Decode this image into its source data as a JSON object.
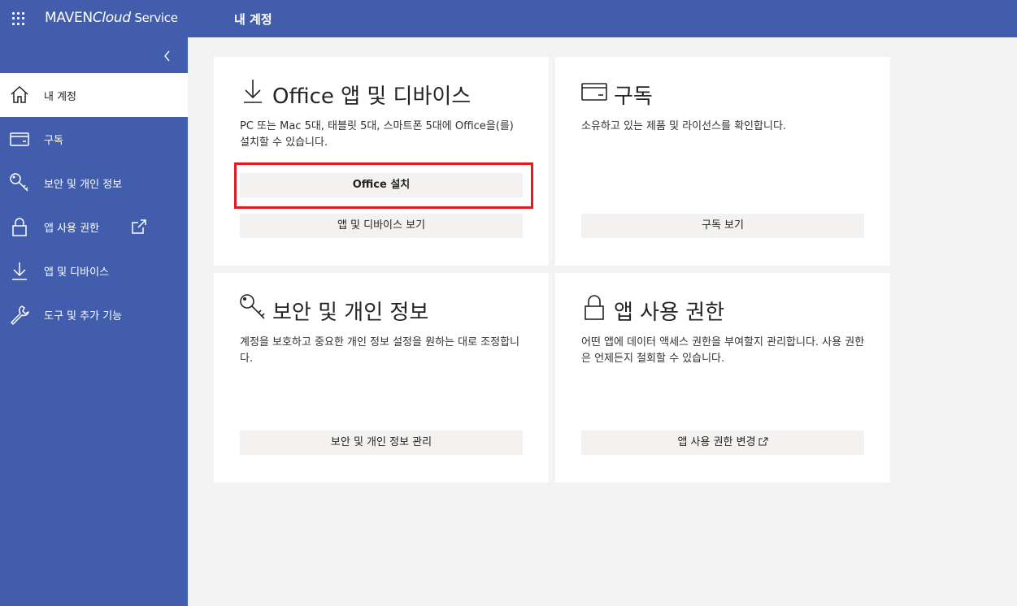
{
  "topbar": {
    "brand_prefix": "MAVEN",
    "brand_cloud": "Cloud",
    "brand_service": " Service",
    "title": "내 계정"
  },
  "sidebar": {
    "items": [
      {
        "label": "내 계정",
        "icon": "home-icon",
        "active": true
      },
      {
        "label": "구독",
        "icon": "card-icon"
      },
      {
        "label": "보안 및 개인 정보",
        "icon": "key-icon"
      },
      {
        "label": "앱 사용 권한",
        "icon": "lock-icon",
        "external": true
      },
      {
        "label": "앱 및 디바이스",
        "icon": "download-icon"
      },
      {
        "label": "도구 및 추가 기능",
        "icon": "wrench-icon"
      }
    ]
  },
  "cards": {
    "office": {
      "title": "Office 앱 및 디바이스",
      "desc": "PC 또는 Mac 5대, 태블릿 5대, 스마트폰 5대에 Office을(를) 설치할 수 있습니다.",
      "install_button": "Office 설치",
      "view_button": "앱 및 디바이스 보기"
    },
    "subscription": {
      "title": "구독",
      "desc": "소유하고 있는 제품 및 라이선스를 확인합니다.",
      "button": "구독 보기"
    },
    "security": {
      "title": "보안 및 개인 정보",
      "desc": "계정을 보호하고 중요한 개인 정보 설정을 원하는 대로 조정합니다.",
      "button": "보안 및 개인 정보 관리"
    },
    "permissions": {
      "title": "앱 사용 권한",
      "desc": "어떤 앱에 데이터 액세스 권한을 부여할지 관리합니다. 사용 권한은 언제든지 철회할 수 있습니다.",
      "button": "앱 사용 권한 변경"
    }
  },
  "colors": {
    "sidebar": "#425dab",
    "highlight": "#e21a22",
    "button": "#f3f2f1",
    "background": "#f3f3f3"
  }
}
